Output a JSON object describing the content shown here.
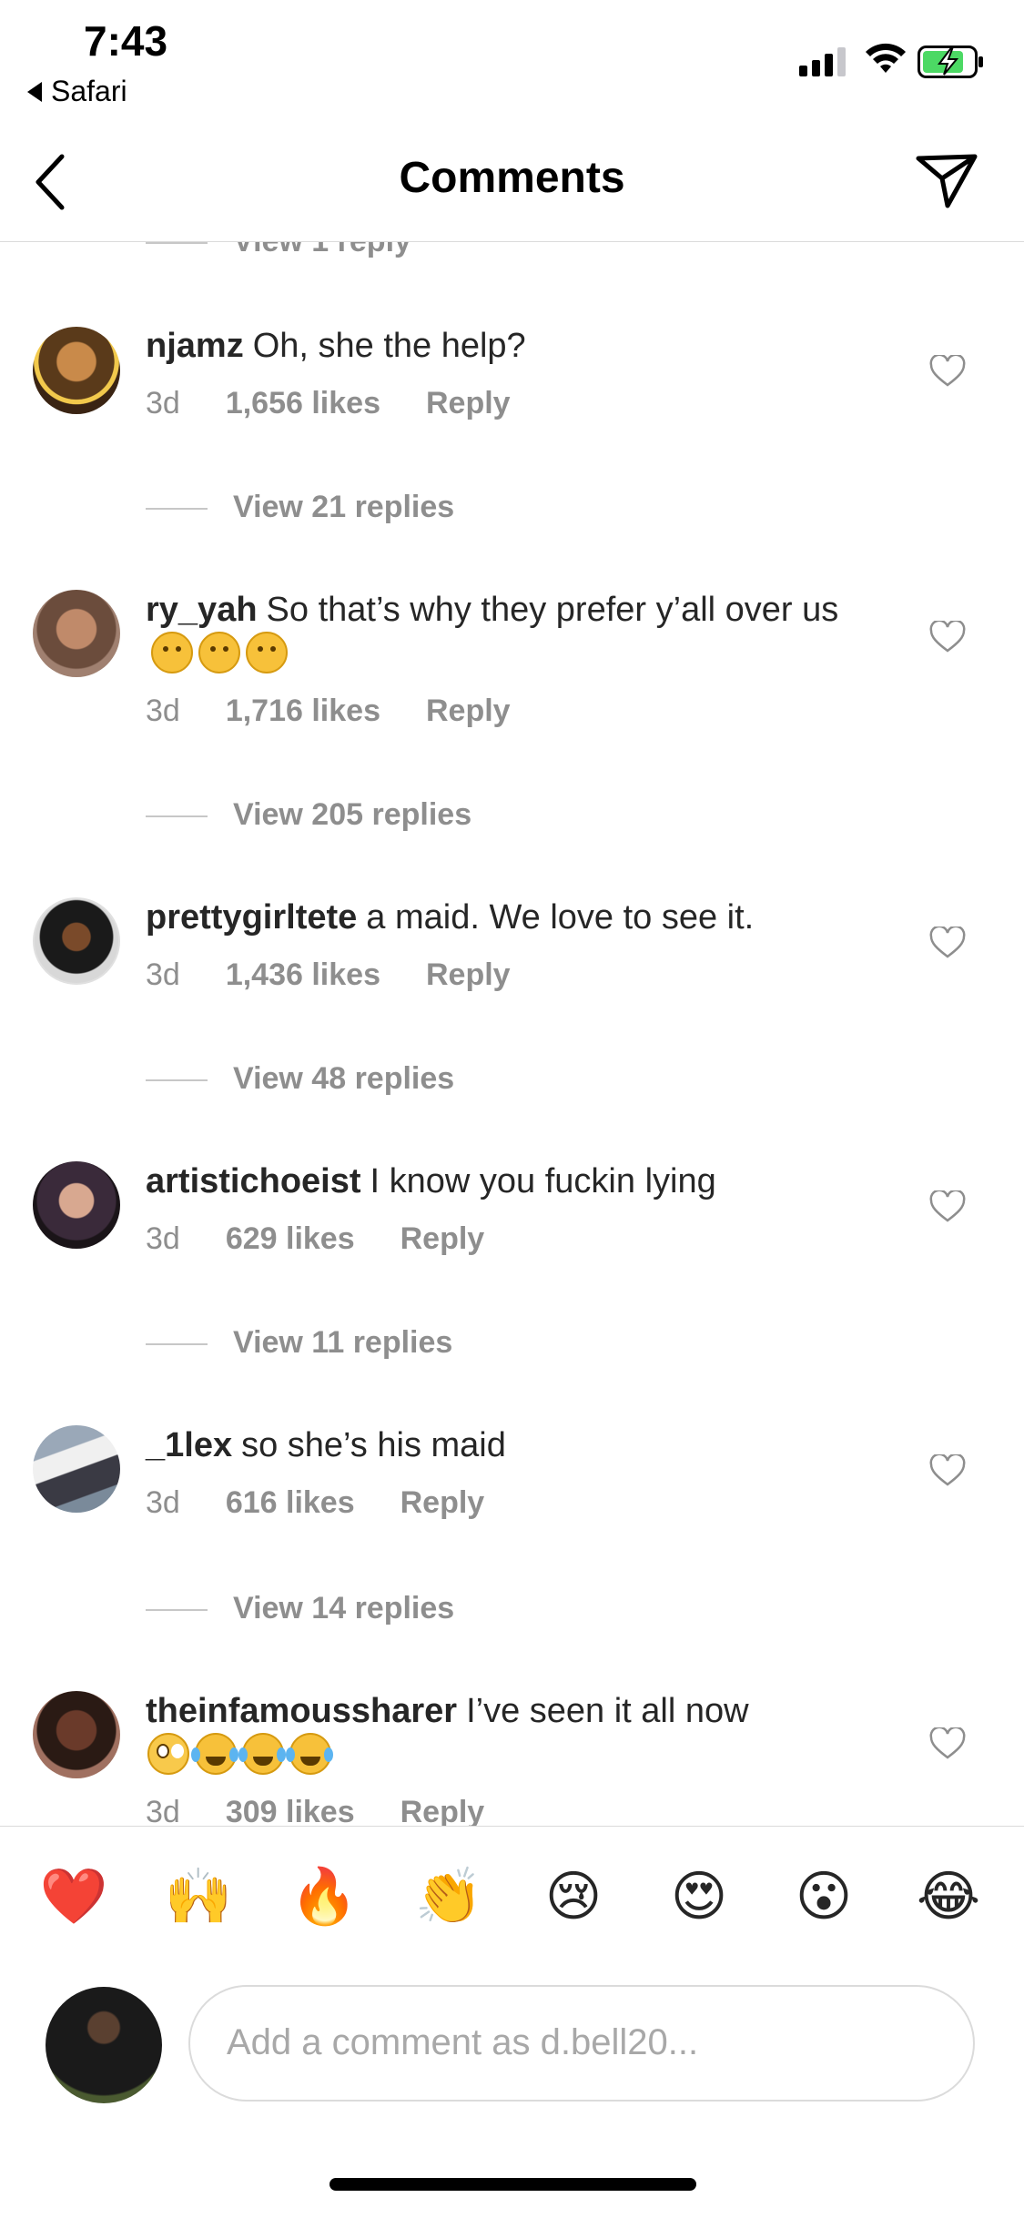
{
  "status": {
    "time": "7:43",
    "back_app": "Safari"
  },
  "header": {
    "title": "Comments"
  },
  "partial_view_replies": "View 1 reply",
  "comments": [
    {
      "username": "njamz",
      "text": "Oh, she the help?",
      "age": "3d",
      "likes": "1,656 likes",
      "reply": "Reply",
      "view_replies": "View 21 replies"
    },
    {
      "username": "ry_yah",
      "text": "So that’s why they prefer y’all over us",
      "age": "3d",
      "likes": "1,716 likes",
      "reply": "Reply",
      "view_replies": "View 205 replies"
    },
    {
      "username": "prettygirltete",
      "text": "a maid. We love to see it.",
      "age": "3d",
      "likes": "1,436 likes",
      "reply": "Reply",
      "view_replies": "View 48 replies"
    },
    {
      "username": "artistichoeist",
      "text": "I know you fuckin lying",
      "age": "3d",
      "likes": "629 likes",
      "reply": "Reply",
      "view_replies": "View 11 replies"
    },
    {
      "username": "_1lex",
      "text": "so she’s his maid",
      "age": "3d",
      "likes": "616 likes",
      "reply": "Reply",
      "view_replies": "View 14 replies"
    },
    {
      "username": "theinfamoussharer",
      "text": "I’ve seen it all now",
      "age": "3d",
      "likes": "309 likes",
      "reply": "Reply"
    }
  ],
  "reactions": [
    "❤️",
    "🙌",
    "🔥",
    "👏",
    "😢",
    "😍",
    "😮",
    "😂"
  ],
  "composer": {
    "placeholder": "Add a comment as d.bell20..."
  }
}
